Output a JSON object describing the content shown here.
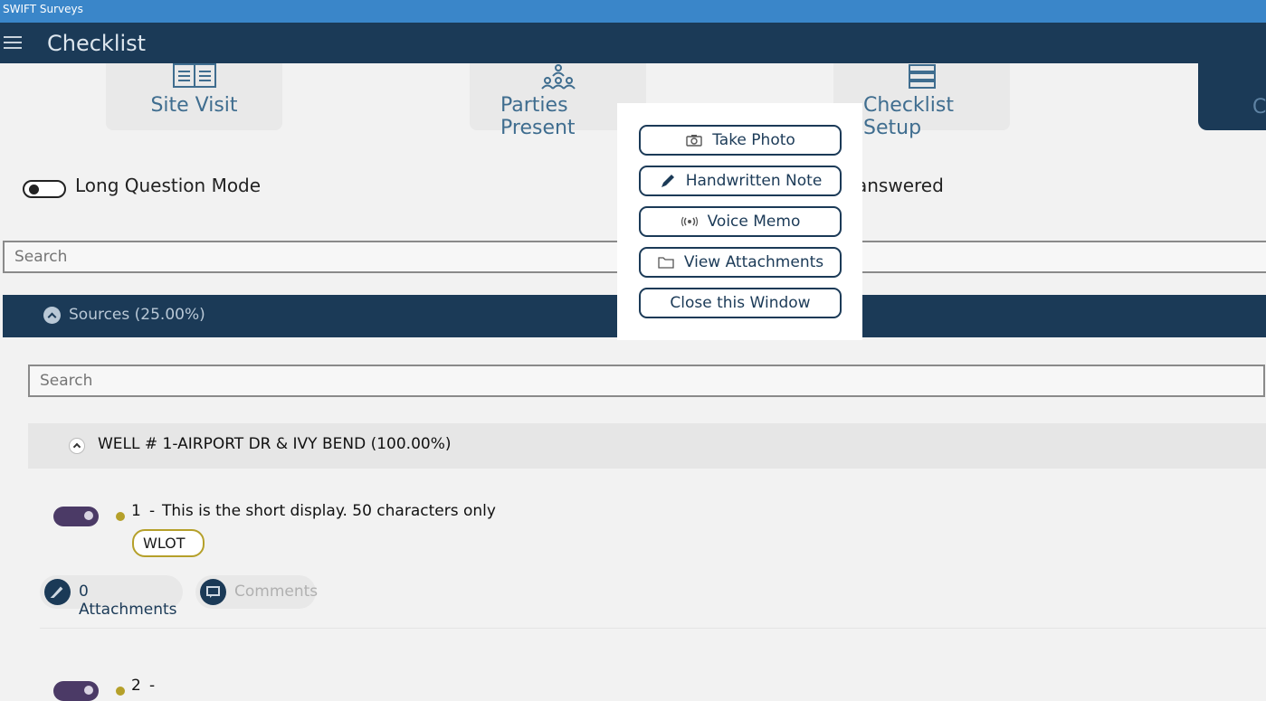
{
  "window": {
    "title": "SWIFT Surveys"
  },
  "appbar": {
    "title": "Checklist",
    "menu_icon": "hamburger-icon"
  },
  "tiles": [
    {
      "label": "Site Visit",
      "icon": "site-visit-icon"
    },
    {
      "label": "Parties Present",
      "icon": "parties-icon"
    },
    {
      "label": "Checklist Setup",
      "icon": "checklist-setup-icon"
    },
    {
      "label": "C"
    }
  ],
  "options": {
    "long_question_mode_label": "Long Question Mode",
    "long_question_mode_on": false,
    "answered_label": "answered"
  },
  "search": {
    "placeholder": "Search"
  },
  "sources": {
    "label": "Sources (25.00%)"
  },
  "sources_search": {
    "placeholder": "Search"
  },
  "well": {
    "label": "WELL # 1-AIRPORT DR & IVY BEND (100.00%)"
  },
  "questions": [
    {
      "number": "1",
      "sep": "-",
      "text": "This is the short display. 50 characters only",
      "tag": "WLOT",
      "toggle_on": true
    },
    {
      "number": "2",
      "sep": "-",
      "text": "",
      "toggle_on": true
    }
  ],
  "footer_actions": {
    "attachments_label": "0 Attachments",
    "comments_label": "Comments"
  },
  "modal": {
    "buttons": [
      {
        "label": "Take Photo",
        "icon": "camera-icon"
      },
      {
        "label": "Handwritten Note",
        "icon": "pen-icon"
      },
      {
        "label": "Voice Memo",
        "icon": "voice-icon"
      },
      {
        "label": "View Attachments",
        "icon": "folder-icon"
      },
      {
        "label": "Close this Window"
      }
    ]
  },
  "colors": {
    "titlebar": "#3a86c9",
    "appbar": "#1b3a57",
    "accent_text": "#3f6d8f",
    "dot": "#b5a02a",
    "toggle_on": "#4b3a66"
  }
}
